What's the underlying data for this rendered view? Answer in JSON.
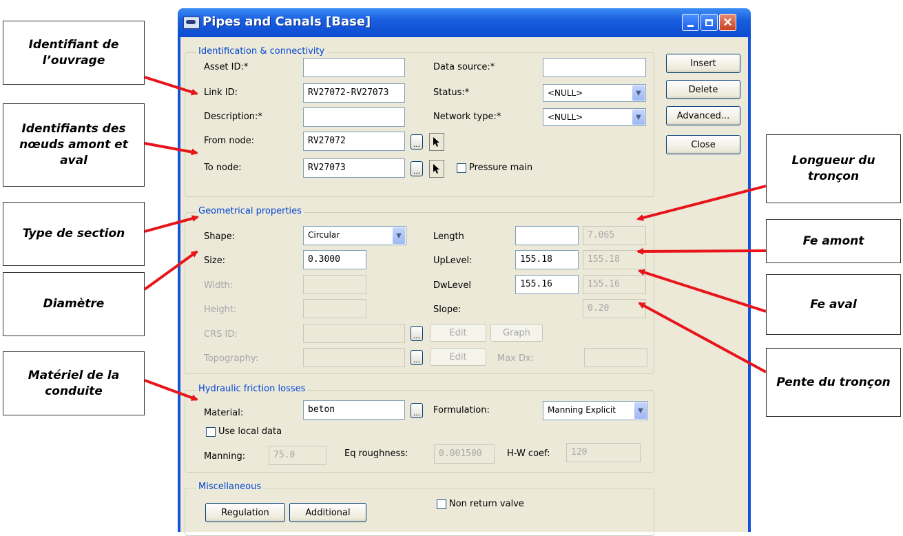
{
  "callouts": {
    "identifiant_ouvrage": "Identifiant de l’ouvrage",
    "identifiants_noeuds": "Identifiants des nœuds amont et aval",
    "type_section": "Type de section",
    "diametre": "Diamètre",
    "materiel": "Matériel de la conduite",
    "longueur": "Longueur du tronçon",
    "fe_amont": "Fe amont",
    "fe_aval": "Fe aval",
    "pente": "Pente du tronçon"
  },
  "window": {
    "title": "Pipes and Canals [Base]"
  },
  "identification": {
    "group_title": "Identification & connectivity",
    "asset_id_label": "Asset ID:*",
    "asset_id_value": "",
    "link_id_label": "Link ID:",
    "link_id_value": "RV27072-RV27073",
    "description_label": "Description:*",
    "description_value": "",
    "from_node_label": "From node:",
    "from_node_value": "RV27072",
    "to_node_label": "To node:",
    "to_node_value": "RV27073",
    "data_source_label": "Data source:*",
    "data_source_value": "",
    "status_label": "Status:*",
    "status_value": "<NULL>",
    "network_type_label": "Network type:*",
    "network_type_value": "<NULL>",
    "pressure_main_label": "Pressure main",
    "pressure_main_checked": false
  },
  "buttons": {
    "insert": "Insert",
    "delete": "Delete",
    "advanced": "Advanced...",
    "close": "Close"
  },
  "geometry": {
    "group_title": "Geometrical properties",
    "shape_label": "Shape:",
    "shape_value": "Circular",
    "size_label": "Size:",
    "size_value": "0.3000",
    "width_label": "Width:",
    "height_label": "Height:",
    "crs_id_label": "CRS ID:",
    "topography_label": "Topography:",
    "length_label": "Length",
    "length_value": "",
    "length_computed": "7.065",
    "uplevel_label": "UpLevel:",
    "uplevel_value": "155.18",
    "uplevel_computed": "155.18",
    "dwlevel_label": "DwLevel",
    "dwlevel_value": "155.16",
    "dwlevel_computed": "155.16",
    "slope_label": "Slope:",
    "slope_value": "0.20",
    "edit_label": "Edit",
    "graph_label": "Graph",
    "maxdx_label": "Max Dx:"
  },
  "hydraulic": {
    "group_title": "Hydraulic friction losses",
    "material_label": "Material:",
    "material_value": "beton",
    "formulation_label": "Formulation:",
    "formulation_value": "Manning Explicit",
    "use_local_label": "Use local data",
    "manning_label": "Manning:",
    "manning_value": "75.0",
    "eq_roughness_label": "Eq roughness:",
    "eq_roughness_value": "0.001500",
    "hw_coef_label": "H-W coef:",
    "hw_coef_value": "120"
  },
  "misc": {
    "group_title": "Miscellaneous",
    "regulation": "Regulation",
    "additional": "Additional",
    "non_return_label": "Non return valve"
  },
  "colors": {
    "arrow": "#e8141b",
    "title_blue": "#0d4bd0",
    "group_title": "#0046d5"
  }
}
